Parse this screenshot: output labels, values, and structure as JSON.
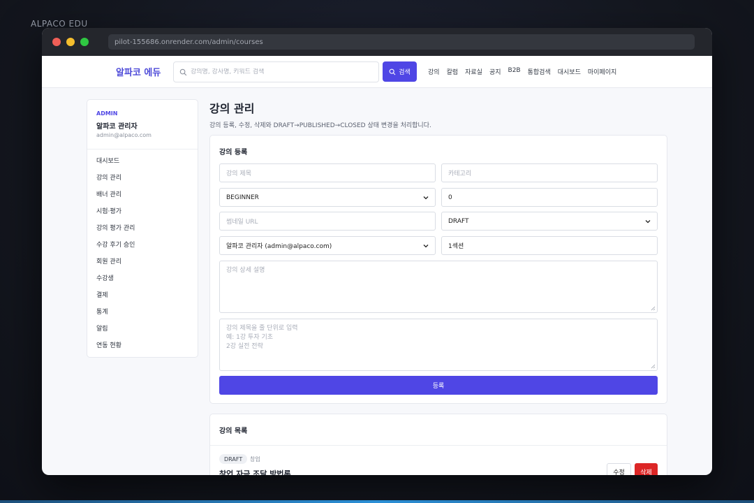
{
  "brand_label": "ALPACO EDU",
  "browser": {
    "url": "pilot-155686.onrender.com/admin/courses"
  },
  "nav": {
    "logo": "알파코 에듀",
    "search_placeholder": "강의명, 강사명, 키워드 검색",
    "search_button": "검색",
    "links": [
      "강의",
      "칼럼",
      "자료실",
      "공지",
      "B2B",
      "통합검색",
      "대시보드",
      "마이페이지"
    ]
  },
  "sidebar": {
    "role": "ADMIN",
    "name": "알파코 관리자",
    "email": "admin@alpaco.com",
    "items": [
      "대시보드",
      "강의 관리",
      "배너 관리",
      "시험·평가",
      "강의 평가 관리",
      "수강 후기 승인",
      "회원 관리",
      "수강생",
      "결제",
      "통계",
      "알림",
      "연동 현황"
    ]
  },
  "page": {
    "title": "강의 관리",
    "description": "강의 등록, 수정, 삭제와 DRAFT→PUBLISHED→CLOSED 상태 변경을 처리합니다."
  },
  "form": {
    "title": "강의 등록",
    "course_title_placeholder": "강의 제목",
    "category_placeholder": "카테고리",
    "level_value": "BEGINNER",
    "price_value": "0",
    "thumbnail_placeholder": "썸네일 URL",
    "status_value": "DRAFT",
    "instructor_value": "알파코 관리자 (admin@alpaco.com)",
    "section_value": "1섹션",
    "description_placeholder": "강의 상세 설명",
    "lessons_placeholder": [
      "강의 제목을 줄 단위로 입력",
      "예: 1강 투자 기초",
      "2강 실전 전략"
    ],
    "submit_label": "등록"
  },
  "course_list": {
    "title": "강의 목록",
    "items": [
      {
        "status": "DRAFT",
        "category": "창업",
        "title": "창업 자금 조달 방법론",
        "edit_label": "수정",
        "delete_label": "삭제"
      }
    ]
  },
  "colors": {
    "accent": "#4f46e5",
    "danger": "#dc2626"
  }
}
